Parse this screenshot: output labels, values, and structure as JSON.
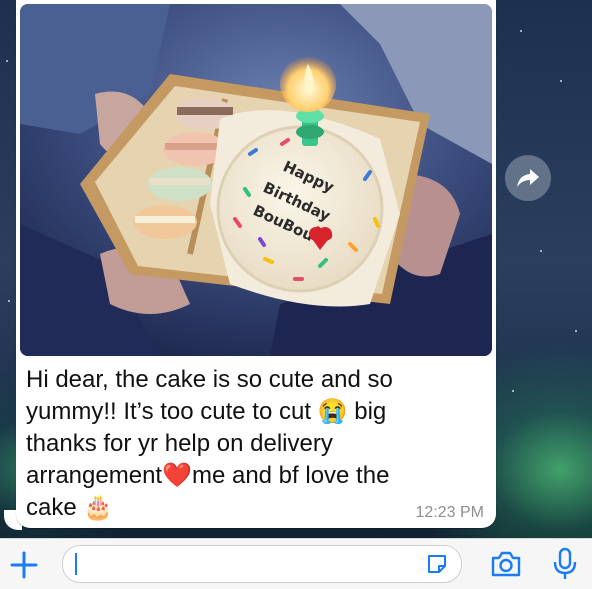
{
  "chat": {
    "message": {
      "text": "Hi dear, the cake is so cute and so\nyummy!! It’s too cute to cut 😭 big\nthanks for yr help on delivery\narrangement❤️me and bf love the\ncake 🎂",
      "time": "12:23 PM"
    },
    "photo": {
      "cake_text_line1": "Happy",
      "cake_text_line2": "Birthday",
      "cake_text_line3": "BouBou"
    }
  },
  "input_bar": {
    "value": ""
  },
  "colors": {
    "accent": "#1a7cf5",
    "bubble": "#ffffff",
    "wallpaper": "#1c3150"
  },
  "icons": {
    "add": "plus-icon",
    "forward": "forward-arrow-icon",
    "sticker": "sticker-icon",
    "camera": "camera-icon",
    "microphone": "microphone-icon"
  }
}
